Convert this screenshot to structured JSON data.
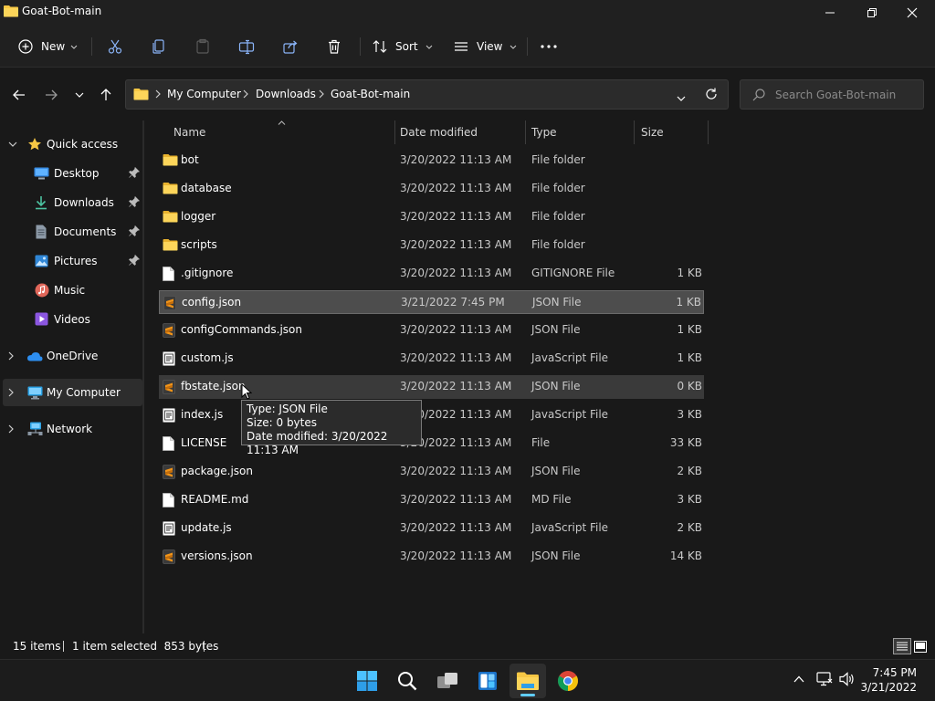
{
  "window": {
    "title": "Goat-Bot-main"
  },
  "commandbar": {
    "new_label": "New",
    "sort_label": "Sort",
    "view_label": "View"
  },
  "address": {
    "crumbs": [
      "My Computer",
      "Downloads",
      "Goat-Bot-main"
    ]
  },
  "search": {
    "placeholder": "Search Goat-Bot-main"
  },
  "sidebar": {
    "items": [
      {
        "label": "Quick access"
      },
      {
        "label": "Desktop"
      },
      {
        "label": "Downloads"
      },
      {
        "label": "Documents"
      },
      {
        "label": "Pictures"
      },
      {
        "label": "Music"
      },
      {
        "label": "Videos"
      },
      {
        "label": "OneDrive"
      },
      {
        "label": "My Computer"
      },
      {
        "label": "Network"
      }
    ]
  },
  "columns": {
    "name": "Name",
    "date": "Date modified",
    "type": "Type",
    "size": "Size"
  },
  "files": [
    {
      "name": "bot",
      "date": "3/20/2022 11:13 AM",
      "type": "File folder",
      "size": "",
      "icon": "folder"
    },
    {
      "name": "database",
      "date": "3/20/2022 11:13 AM",
      "type": "File folder",
      "size": "",
      "icon": "folder"
    },
    {
      "name": "logger",
      "date": "3/20/2022 11:13 AM",
      "type": "File folder",
      "size": "",
      "icon": "folder"
    },
    {
      "name": "scripts",
      "date": "3/20/2022 11:13 AM",
      "type": "File folder",
      "size": "",
      "icon": "folder"
    },
    {
      "name": ".gitignore",
      "date": "3/20/2022 11:13 AM",
      "type": "GITIGNORE File",
      "size": "1 KB",
      "icon": "file"
    },
    {
      "name": "config.json",
      "date": "3/21/2022 7:45 PM",
      "type": "JSON File",
      "size": "1 KB",
      "icon": "sublime"
    },
    {
      "name": "configCommands.json",
      "date": "3/20/2022 11:13 AM",
      "type": "JSON File",
      "size": "1 KB",
      "icon": "sublime"
    },
    {
      "name": "custom.js",
      "date": "3/20/2022 11:13 AM",
      "type": "JavaScript File",
      "size": "1 KB",
      "icon": "script"
    },
    {
      "name": "fbstate.json",
      "date": "3/20/2022 11:13 AM",
      "type": "JSON File",
      "size": "0 KB",
      "icon": "sublime"
    },
    {
      "name": "index.js",
      "date": "3/20/2022 11:13 AM",
      "type": "JavaScript File",
      "size": "3 KB",
      "icon": "script"
    },
    {
      "name": "LICENSE",
      "date": "3/20/2022 11:13 AM",
      "type": "File",
      "size": "33 KB",
      "icon": "file"
    },
    {
      "name": "package.json",
      "date": "3/20/2022 11:13 AM",
      "type": "JSON File",
      "size": "2 KB",
      "icon": "sublime"
    },
    {
      "name": "README.md",
      "date": "3/20/2022 11:13 AM",
      "type": "MD File",
      "size": "3 KB",
      "icon": "file"
    },
    {
      "name": "update.js",
      "date": "3/20/2022 11:13 AM",
      "type": "JavaScript File",
      "size": "2 KB",
      "icon": "script"
    },
    {
      "name": "versions.json",
      "date": "3/20/2022 11:13 AM",
      "type": "JSON File",
      "size": "14 KB",
      "icon": "sublime"
    }
  ],
  "selected_file": "config.json",
  "hovered_file": "fbstate.json",
  "tooltip": {
    "line1": "Type: JSON File",
    "line2": "Size: 0 bytes",
    "line3": "Date modified: 3/20/2022 11:13 AM"
  },
  "status": {
    "item_count": "15 items",
    "selection": "1 item selected  853 bytes"
  },
  "clock": {
    "time": "7:45 PM",
    "date": "3/21/2022"
  },
  "colors": {
    "accent": "#60cdff",
    "folder": "#f6c744",
    "sublime": "#f29418"
  }
}
